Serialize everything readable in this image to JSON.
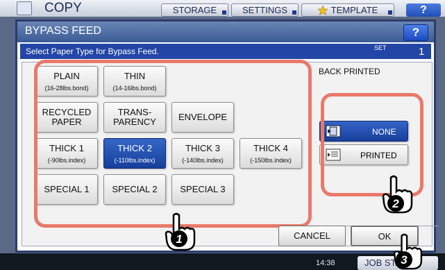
{
  "header": {
    "app_title": "COPY",
    "buttons": [
      {
        "label": "STORAGE"
      },
      {
        "label": "SETTINGS"
      },
      {
        "label": "TEMPLATE",
        "icon": "star-icon"
      }
    ],
    "help_label": "?"
  },
  "dialog": {
    "title": "BYPASS FEED",
    "help_label": "?",
    "instruction": "Select Paper Type for Bypass Feed.",
    "set_label": "SET",
    "set_count": "1"
  },
  "paper_types": [
    {
      "label": "PLAIN",
      "sub": "(16-28lbs.bond)",
      "selected": false
    },
    {
      "label": "THIN",
      "sub": "(14-16lbs.bond)",
      "selected": false
    },
    {
      "label": "RECYCLED\nPAPER",
      "sub": "",
      "selected": false
    },
    {
      "label": "TRANS-\nPARENCY",
      "sub": "",
      "selected": false
    },
    {
      "label": "ENVELOPE",
      "sub": "",
      "selected": false
    },
    {
      "label": "THICK 1",
      "sub": "(-90lbs.index)",
      "selected": false
    },
    {
      "label": "THICK 2",
      "sub": "(-110lbs.index)",
      "selected": true
    },
    {
      "label": "THICK 3",
      "sub": "(-140lbs.index)",
      "selected": false
    },
    {
      "label": "THICK 4",
      "sub": "(-150lbs.index)",
      "selected": false
    },
    {
      "label": "SPECIAL 1",
      "sub": "",
      "selected": false
    },
    {
      "label": "SPECIAL 2",
      "sub": "",
      "selected": false
    },
    {
      "label": "SPECIAL 3",
      "sub": "",
      "selected": false
    }
  ],
  "back_printed": {
    "title": "BACK PRINTED",
    "options": [
      {
        "label": "NONE",
        "selected": true
      },
      {
        "label": "PRINTED",
        "selected": false
      }
    ]
  },
  "actions": {
    "cancel_label": "CANCEL",
    "ok_label": "OK"
  },
  "callouts": [
    "1",
    "2",
    "3"
  ],
  "status": {
    "clock": "14:38",
    "job_button": "JOB STATUS"
  },
  "colors": {
    "accent": "#2346a6",
    "selected": "#1f4aa8",
    "highlight": "#e9796a"
  }
}
